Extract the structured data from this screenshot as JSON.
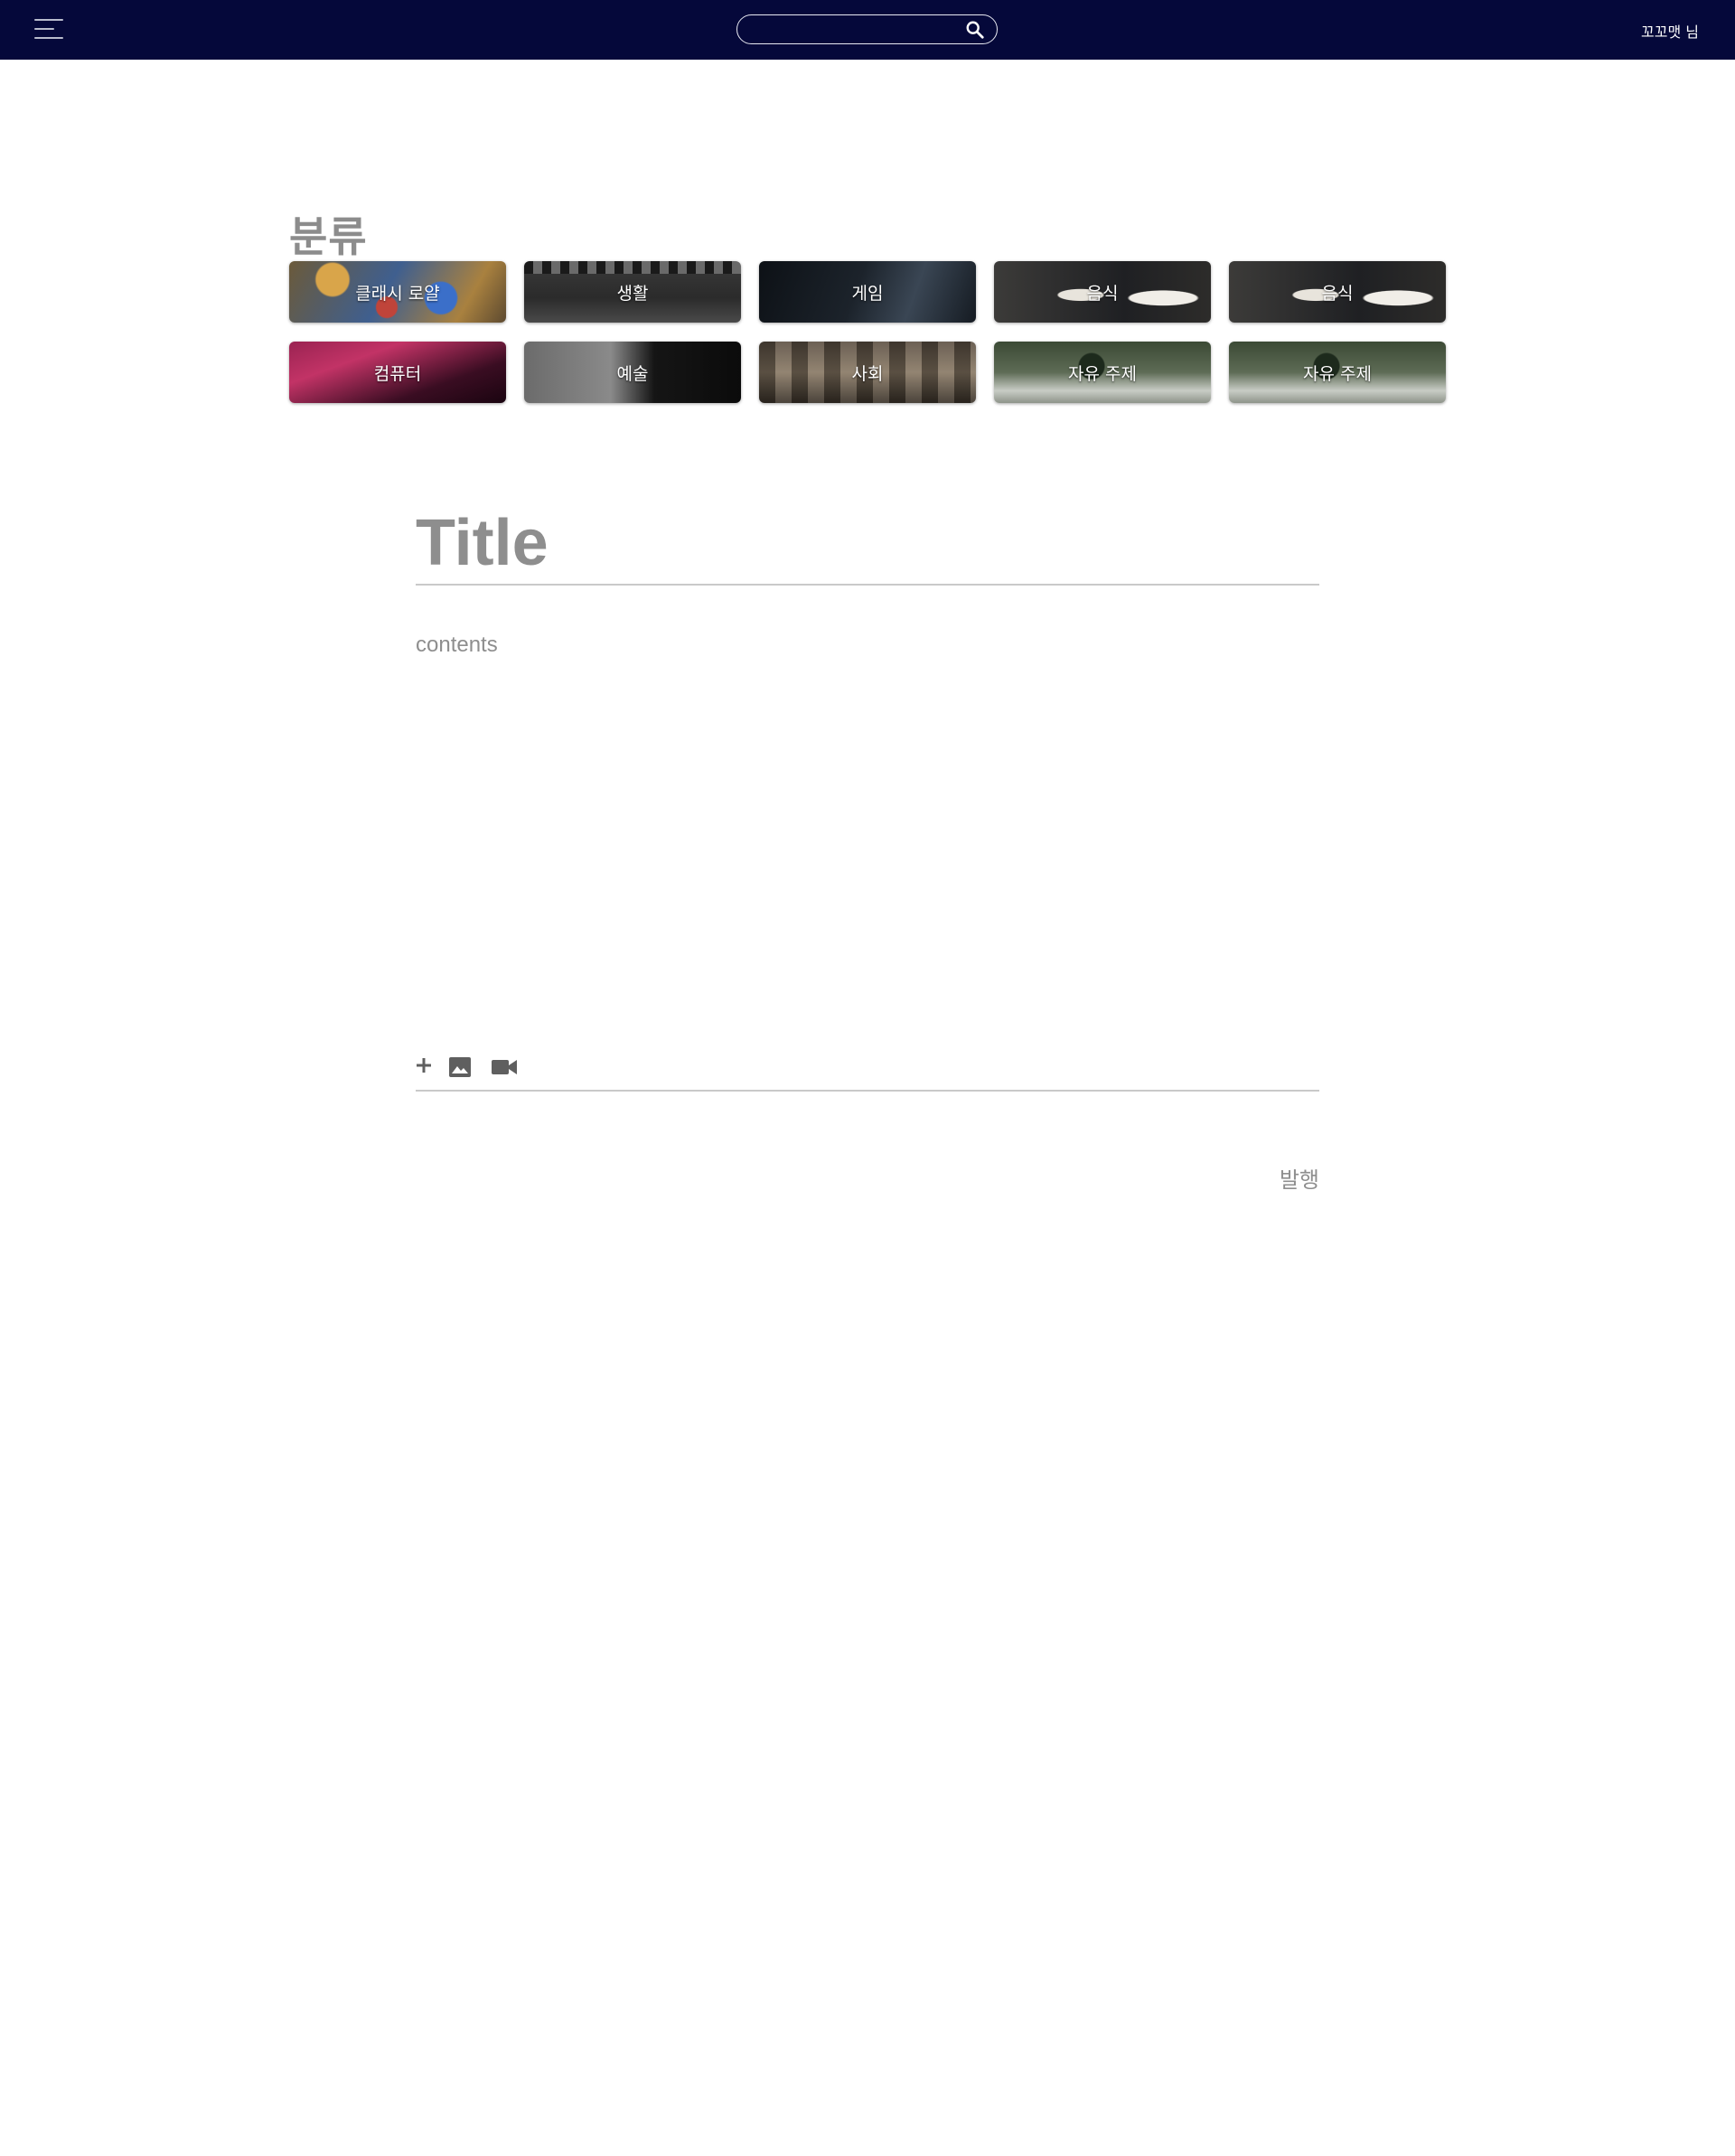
{
  "header": {
    "search_placeholder": "",
    "user_label": "꼬꼬맷 님"
  },
  "category": {
    "heading": "분류",
    "items": [
      {
        "label": "클래시 로얄"
      },
      {
        "label": "생활"
      },
      {
        "label": "게임"
      },
      {
        "label": "음식"
      },
      {
        "label": "음식"
      },
      {
        "label": "컴퓨터"
      },
      {
        "label": "예술"
      },
      {
        "label": "사회"
      },
      {
        "label": "자유 주제"
      },
      {
        "label": "자유 주제"
      }
    ]
  },
  "editor": {
    "title_placeholder": "Title",
    "title_value": "",
    "content_placeholder": "contents",
    "content_value": "",
    "toolbar_icons": [
      "plus-icon",
      "image-icon",
      "video-camera-icon"
    ],
    "publish_label": "발행"
  },
  "colors": {
    "navbar": "#05083a",
    "muted_text": "#8e8e8e",
    "divider": "#c9c9c9"
  }
}
